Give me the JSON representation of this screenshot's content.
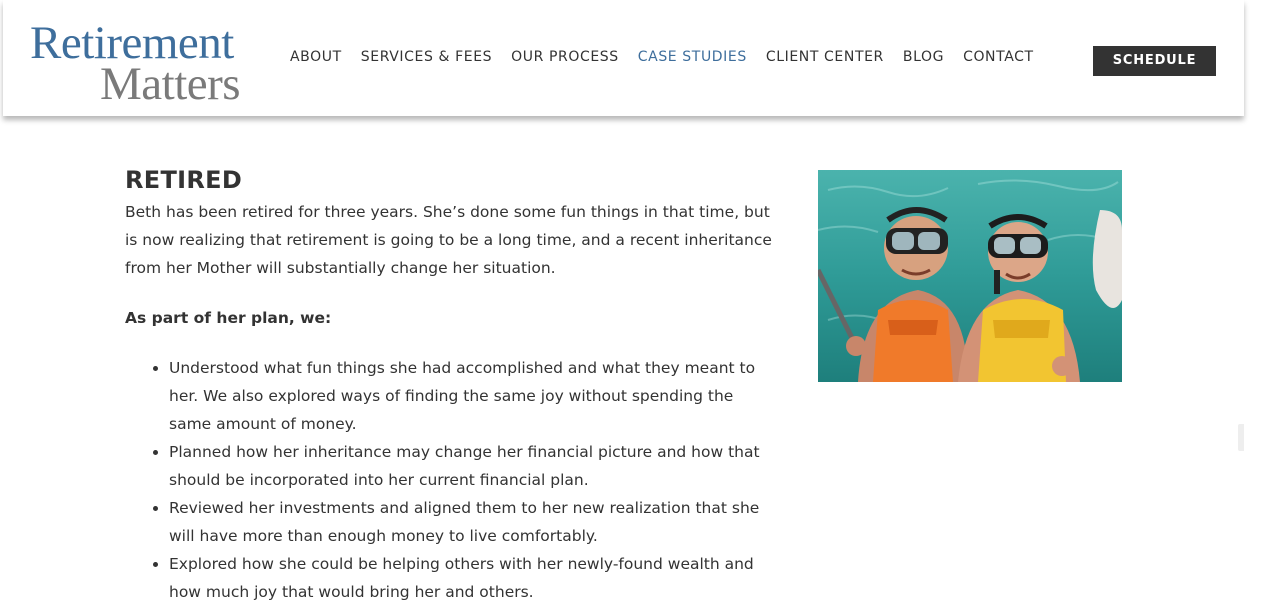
{
  "logo": {
    "line1": "Retirement",
    "line2": "Matters"
  },
  "nav": {
    "items": [
      {
        "label": "ABOUT"
      },
      {
        "label": "SERVICES & FEES"
      },
      {
        "label": "OUR PROCESS"
      },
      {
        "label": "CASE STUDIES"
      },
      {
        "label": "CLIENT CENTER"
      },
      {
        "label": "BLOG"
      },
      {
        "label": "CONTACT"
      }
    ],
    "active": "CASE STUDIES",
    "schedule_label": "SCHEDULE"
  },
  "colors": {
    "brand_blue": "#3e6e9c",
    "logo_gray": "#7a7a7a",
    "text": "#333333",
    "button_bg": "#333333"
  },
  "main": {
    "title": "RETIRED",
    "intro": "Beth has been retired for three years. She’s done some fun things in that time, but is now realizing that retirement is going to be a long time, and a recent inheritance from her Mother will substantially change her situation.",
    "plan_heading": "As part of her plan, we:",
    "bullets": [
      "Understood what fun things she had accomplished and what they meant to her. We also explored ways of finding the same joy without spending the same amount of money.",
      "Planned how her inheritance may change her financial picture and how that should be incorporated into her current financial plan.",
      "Reviewed her investments and aligned them to her new realization that she will have more than enough money to live comfortably.",
      "Explored how she could be helping others with her newly-found wealth and how much joy that would bring her and others."
    ]
  },
  "photo": {
    "subject": "two-snorkelers-selfie-image"
  }
}
